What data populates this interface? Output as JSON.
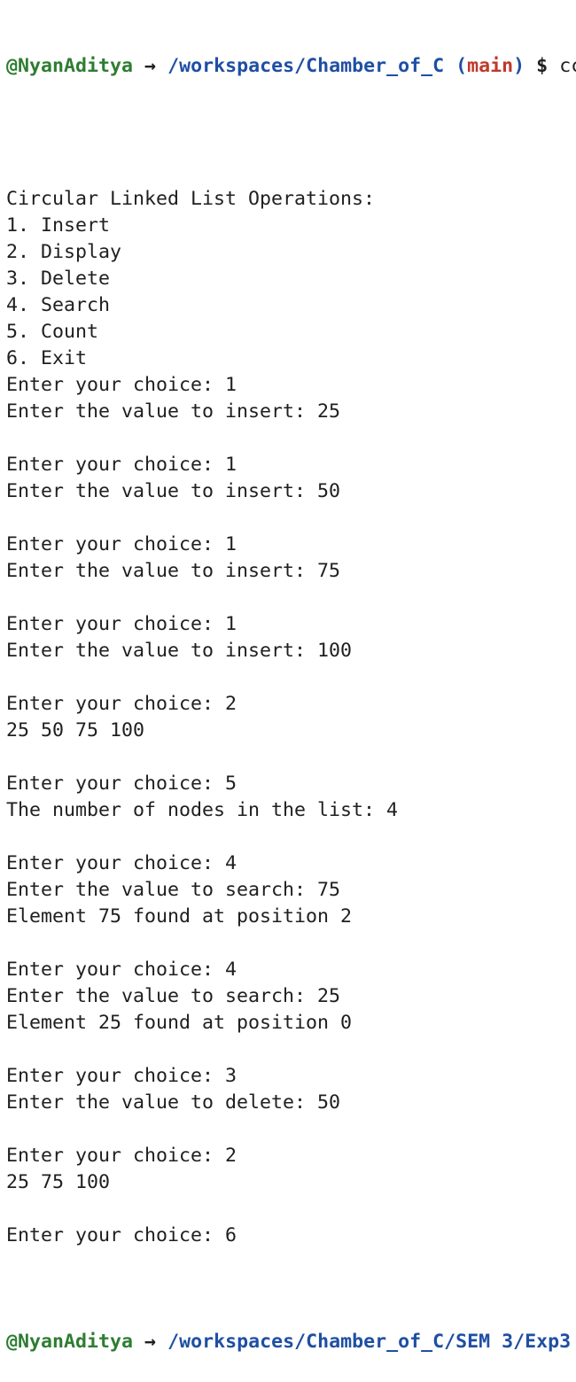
{
  "colors": {
    "user": "#2e7d32",
    "path": "#1f4fa3",
    "branch": "#c0392b",
    "text": "#1f1f1f",
    "background": "#ffffff"
  },
  "prompt_top": {
    "user": "@NyanAditya",
    "arrow": "→",
    "path": "/workspaces/Chamber_of_C",
    "branch_open": "(",
    "branch": "main",
    "branch_close": ")",
    "dollar": "$",
    "command": "cc"
  },
  "output_lines": [
    "",
    "Circular Linked List Operations:",
    "1. Insert",
    "2. Display",
    "3. Delete",
    "4. Search",
    "5. Count",
    "6. Exit",
    "Enter your choice: 1",
    "Enter the value to insert: 25",
    "",
    "Enter your choice: 1",
    "Enter the value to insert: 50",
    "",
    "Enter your choice: 1",
    "Enter the value to insert: 75",
    "",
    "Enter your choice: 1",
    "Enter the value to insert: 100",
    "",
    "Enter your choice: 2",
    "25 50 75 100",
    "",
    "Enter your choice: 5",
    "The number of nodes in the list: 4",
    "",
    "Enter your choice: 4",
    "Enter the value to search: 75",
    "Element 75 found at position 2",
    "",
    "Enter your choice: 4",
    "Enter the value to search: 25",
    "Element 25 found at position 0",
    "",
    "Enter your choice: 3",
    "Enter the value to delete: 50",
    "",
    "Enter your choice: 2",
    "25 75 100",
    "",
    "Enter your choice: 6"
  ],
  "prompt_bottom": {
    "user": "@NyanAditya",
    "arrow": "→",
    "path": "/workspaces/Chamber_of_C/SEM 3/Exp3"
  }
}
